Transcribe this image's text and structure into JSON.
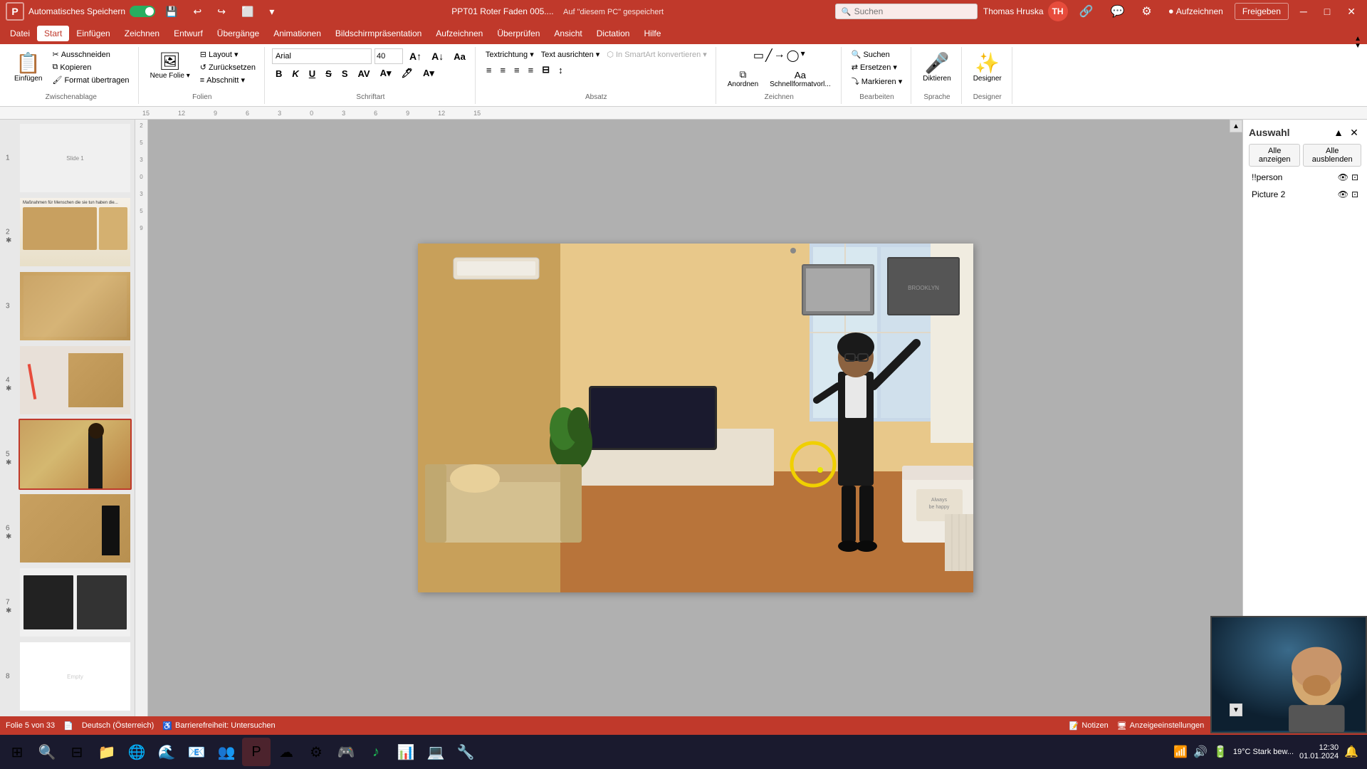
{
  "titlebar": {
    "autosave_label": "Automatisches Speichern",
    "filename": "PPT01 Roter Faden 005....",
    "save_status": "Auf \"diesem PC\" gespeichert",
    "user_name": "Thomas Hruska",
    "user_initials": "TH",
    "undo_icon": "↩",
    "redo_icon": "↪",
    "minimize_icon": "─",
    "maximize_icon": "□",
    "close_icon": "✕"
  },
  "menubar": {
    "items": [
      {
        "label": "Datei",
        "active": false
      },
      {
        "label": "Start",
        "active": true
      },
      {
        "label": "Einfügen",
        "active": false
      },
      {
        "label": "Zeichnen",
        "active": false
      },
      {
        "label": "Entwurf",
        "active": false
      },
      {
        "label": "Übergänge",
        "active": false
      },
      {
        "label": "Animationen",
        "active": false
      },
      {
        "label": "Bildschirmpräsentation",
        "active": false
      },
      {
        "label": "Aufzeichnen",
        "active": false
      },
      {
        "label": "Überprüfen",
        "active": false
      },
      {
        "label": "Ansicht",
        "active": false
      },
      {
        "label": "Dictation",
        "active": false
      },
      {
        "label": "Hilfe",
        "active": false
      }
    ]
  },
  "ribbon": {
    "groups": [
      {
        "name": "clipboard",
        "label": "Zwischenablage",
        "buttons": [
          {
            "label": "Einfügen",
            "icon": "📋"
          },
          {
            "label": "Ausschneiden",
            "icon": "✂"
          },
          {
            "label": "Kopieren",
            "icon": "⧉"
          },
          {
            "label": "Format übertragen",
            "icon": "🖌"
          }
        ]
      }
    ],
    "font_family": "Arial",
    "font_size": "40",
    "neue_folie_label": "Neue Folie",
    "layout_label": "Layout",
    "zuruecksetzen_label": "Zurücksetzen",
    "abschnitt_label": "Abschnitt",
    "diktieren_label": "Diktieren",
    "designer_label": "Designer",
    "aufzeichnen_label": "Aufzeichnen",
    "freigeben_label": "Freigeben",
    "suchen_placeholder": "Suchen"
  },
  "selection_panel": {
    "title": "Auswahl",
    "show_all_label": "Alle anzeigen",
    "hide_all_label": "Alle ausblenden",
    "items": [
      {
        "name": "!!person",
        "visible": true
      },
      {
        "name": "Picture 2",
        "visible": true
      }
    ]
  },
  "slides": [
    {
      "num": 1,
      "active": false,
      "star": false
    },
    {
      "num": 2,
      "active": false,
      "star": true
    },
    {
      "num": 3,
      "active": false,
      "star": false
    },
    {
      "num": 4,
      "active": false,
      "star": true
    },
    {
      "num": 5,
      "active": true,
      "star": true
    },
    {
      "num": 6,
      "active": false,
      "star": true
    },
    {
      "num": 7,
      "active": false,
      "star": true
    },
    {
      "num": 8,
      "active": false,
      "star": false
    }
  ],
  "statusbar": {
    "slide_info": "Folie 5 von 33",
    "language": "Deutsch (Österreich)",
    "accessibility": "Barrierefreiheit: Untersuchen",
    "notes_label": "Notizen",
    "display_settings_label": "Anzeigeeinstellungen",
    "zoom_icon": "⊞"
  },
  "taskbar": {
    "weather": "19°C  Stark bew..."
  }
}
